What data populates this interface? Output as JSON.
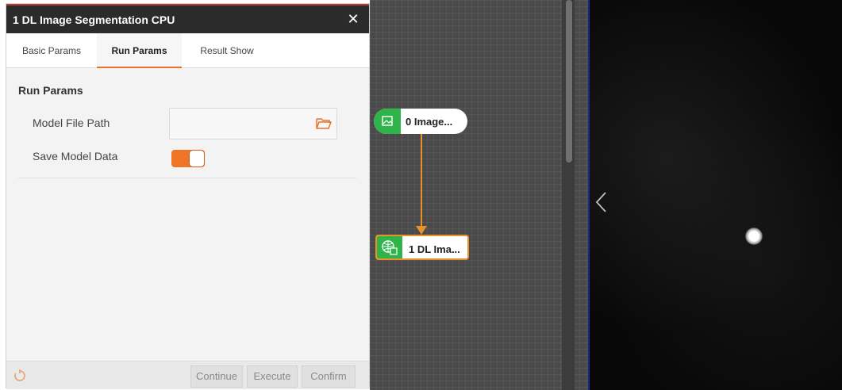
{
  "dialog": {
    "title": "1 DL Image Segmentation CPU",
    "close_symbol": "✕",
    "tabs": [
      {
        "label": "Basic Params",
        "active": false
      },
      {
        "label": "Run Params",
        "active": true
      },
      {
        "label": "Result Show",
        "active": false
      }
    ],
    "section_title": "Run Params",
    "fields": {
      "model_file_path": {
        "label": "Model File Path",
        "value": "",
        "placeholder": "",
        "icon": "folder-open-icon"
      },
      "save_model_data": {
        "label": "Save Model Data",
        "checked": true
      }
    },
    "footer": {
      "reset_icon": "reset-icon",
      "buttons": [
        "Continue",
        "Execute",
        "Confirm"
      ]
    }
  },
  "canvas": {
    "nodes": [
      {
        "label": "0 Image...",
        "icon": "image-icon"
      },
      {
        "label": "1 DL Ima...",
        "icon": "dl-segmentation-icon"
      }
    ]
  },
  "colors": {
    "accent": "#f07426",
    "node_green": "#2fb34a",
    "connector": "#e8922a",
    "titlebar": "#2b2b2b"
  }
}
